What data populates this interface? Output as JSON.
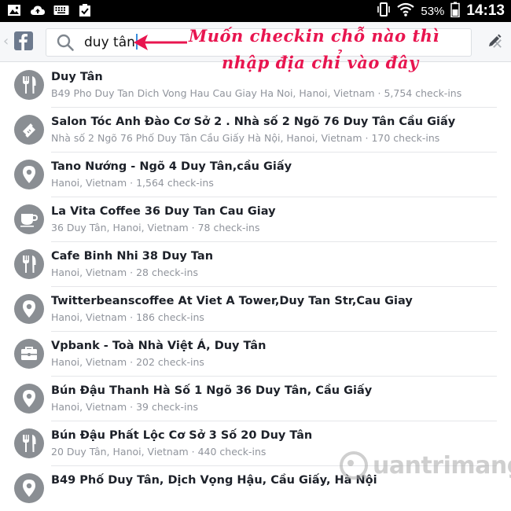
{
  "status_bar": {
    "battery_percent": "53%",
    "time": "14:13",
    "left_icons": [
      "image-icon",
      "cloud-upload-icon",
      "keyboard-icon",
      "clipboard-check-icon"
    ],
    "right_icons": [
      "phone-vibrate-icon",
      "wifi-icon",
      "cellular-signal-icon",
      "battery-icon"
    ]
  },
  "header": {
    "search_value": "duy tân",
    "accent": "#3b8cdc"
  },
  "annotation": {
    "line1": "Muốn checkin chỗ nào thì",
    "line2": "nhập địa chỉ vào đây",
    "color": "#e8154f"
  },
  "results": [
    {
      "title": "Duy Tân",
      "subtitle": "B49 Pho Duy Tan Dich Vong Hau Cau Giay Ha Noi, Hanoi, Vietnam · 5,754 check-ins",
      "icon": "fork-knife-icon"
    },
    {
      "title": "Salon Tóc Anh Đào Cơ Sở 2 . Nhà số 2 Ngõ 76 Duy Tân Cầu Giấy",
      "subtitle": "Nhà số 2 Ngõ 76 Phố Duy Tân Cầu Giấy Hà Nội, Hanoi, Vietnam · 170 check-ins",
      "icon": "ticket-icon"
    },
    {
      "title": "Tano Nướng - Ngõ 4 Duy Tân,cầu Giấy",
      "subtitle": "Hanoi, Vietnam · 1,564 check-ins",
      "icon": "map-pin-icon"
    },
    {
      "title": "La Vita Coffee 36 Duy Tan Cau Giay",
      "subtitle": "36 Duy Tân, Hanoi, Vietnam · 78 check-ins",
      "icon": "coffee-cup-icon"
    },
    {
      "title": "Cafe Binh Nhi 38 Duy Tan",
      "subtitle": "Hanoi, Vietnam · 28 check-ins",
      "icon": "fork-knife-icon"
    },
    {
      "title": "Twitterbeanscoffee At Viet A Tower,Duy Tan Str,Cau Giay",
      "subtitle": "Hanoi, Vietnam · 186 check-ins",
      "icon": "map-pin-icon"
    },
    {
      "title": "Vpbank - Toà Nhà Việt Á, Duy Tân",
      "subtitle": "Hanoi, Vietnam · 202 check-ins",
      "icon": "briefcase-icon"
    },
    {
      "title": "Bún Đậu Thanh Hà Số 1 Ngõ 36 Duy Tân, Cầu Giấy",
      "subtitle": "Hanoi, Vietnam · 39 check-ins",
      "icon": "map-pin-icon"
    },
    {
      "title": "Bún Đậu Phất Lộc Cơ Sở 3 Số 20 Duy Tân",
      "subtitle": "20 Duy Tân, Hanoi, Vietnam · 440 check-ins",
      "icon": "fork-knife-icon"
    },
    {
      "title": "B49 Phố Duy Tân, Dịch Vọng Hậu, Cầu Giấy, Hà Nội",
      "subtitle": "",
      "icon": "map-pin-icon"
    }
  ],
  "watermark": {
    "text": "uantrimang"
  }
}
